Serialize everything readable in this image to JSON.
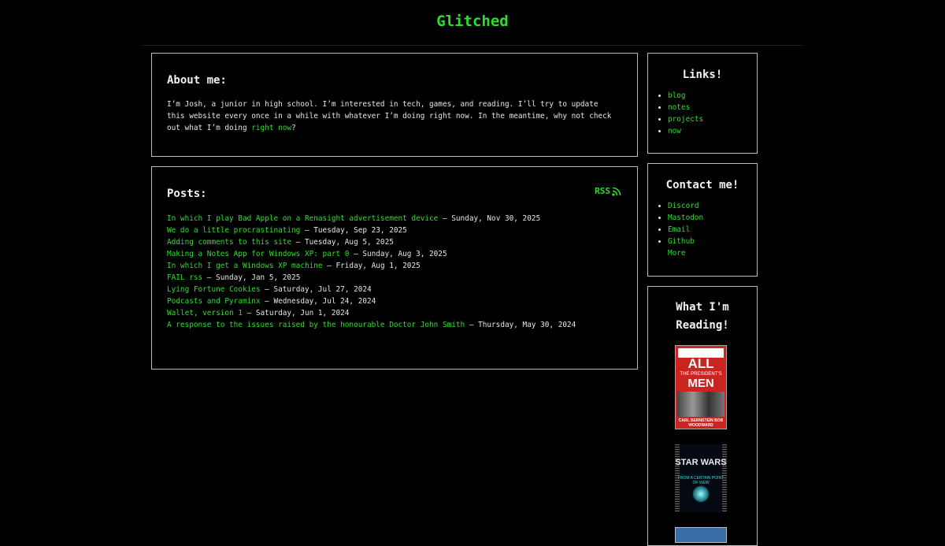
{
  "site": {
    "title": "Glitched"
  },
  "about": {
    "heading": "About me:",
    "text": "I’m Josh, a junior in high school. I’m interested in tech, games, and reading. I’ll try to update this website every once in a while with whatever I’m doing right now. In the meantime, why not check out what I’m doing ",
    "link": "right now",
    "suffix": "?"
  },
  "posts": {
    "heading": "Posts:",
    "rss_label": "RSS",
    "items": [
      {
        "title": "In which I play Bad Apple on a Renasight advertisement device",
        "date": "Sunday, Nov 30, 2025"
      },
      {
        "title": "We do a little procrastinating",
        "date": "Tuesday, Sep 23, 2025"
      },
      {
        "title": "Adding comments to this site",
        "date": "Tuesday, Aug 5, 2025"
      },
      {
        "title": "Making a Notes App for Windows XP: part 0",
        "date": "Sunday, Aug 3, 2025"
      },
      {
        "title": "In which I get a Windows XP machine",
        "date": "Friday, Aug 1, 2025"
      },
      {
        "title": "FAIL rss",
        "date": "Sunday, Jan 5, 2025"
      },
      {
        "title": "Lying Fortune Cookies",
        "date": "Saturday, Jul 27, 2024"
      },
      {
        "title": "Podcasts and Pyraminx",
        "date": "Wednesday, Jul 24, 2024"
      },
      {
        "title": "Wallet, version 1",
        "date": "Saturday, Jun 1, 2024"
      },
      {
        "title": "A response to the issues raised by the honourable Doctor John Smith",
        "date": "Thursday, May 30, 2024"
      }
    ]
  },
  "links": {
    "heading": "Links!",
    "items": [
      "blog",
      "notes",
      "projects",
      "now"
    ]
  },
  "contact": {
    "heading": "Contact me!",
    "items": [
      "Discord",
      "Mastodon",
      "Email",
      "Github"
    ],
    "more": "More"
  },
  "reading": {
    "heading_line1": "What I'm",
    "heading_line2": "Reading!",
    "book1": {
      "line1": "ALL",
      "line2": "THE PRESIDENT'S",
      "line3": "MEN",
      "authors": "CARL BERNSTEIN BOB WOODWARD"
    },
    "book2": {
      "title": "STAR WARS",
      "subtitle": "FROM A CERTAIN POINT OF VIEW"
    }
  },
  "colors": {
    "accent": "#2fdc2f",
    "background": "#000000",
    "border": "#bdbdbd",
    "text": "#e6e6e6"
  },
  "icons": {
    "rss": "rss-icon"
  }
}
